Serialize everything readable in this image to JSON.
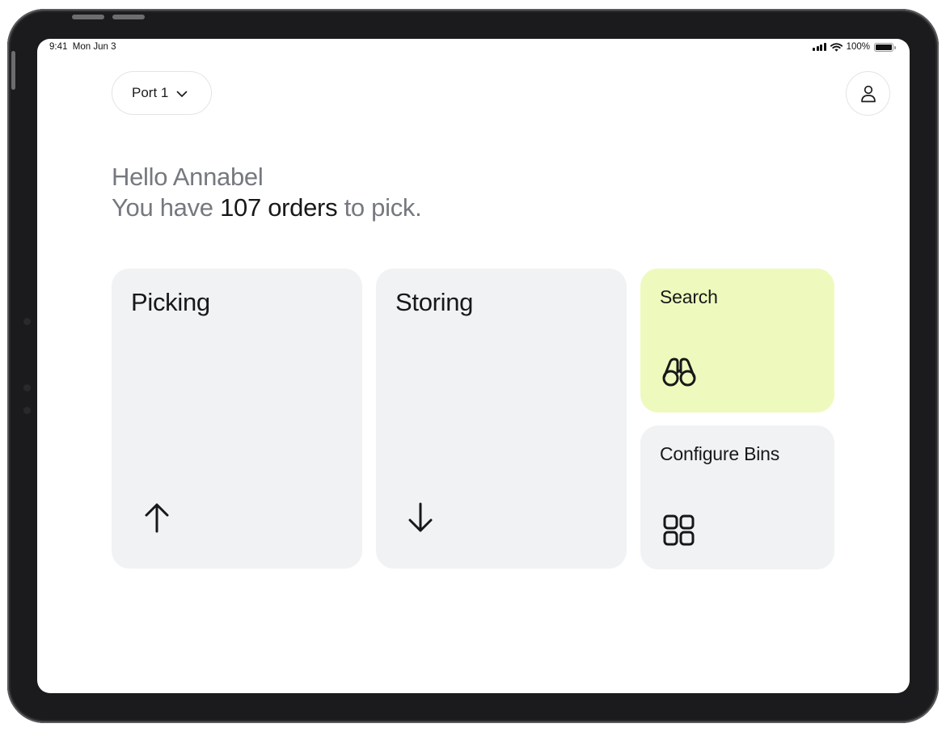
{
  "status_bar": {
    "time": "9:41",
    "date": "Mon Jun 3",
    "battery": "100%",
    "battery_level": 1.0
  },
  "header": {
    "port_selector": {
      "label": "Port 1",
      "icon": "chevron-down-icon"
    },
    "profile": {
      "icon": "user-icon"
    }
  },
  "greeting": {
    "line1": "Hello Annabel",
    "line2_prefix": "You have ",
    "line2_highlight": "107 orders",
    "line2_suffix": " to pick."
  },
  "tiles": {
    "picking": {
      "label": "Picking",
      "icon": "arrow-up-icon"
    },
    "storing": {
      "label": "Storing",
      "icon": "arrow-down-icon"
    },
    "search": {
      "label": "Search",
      "icon": "binoculars-icon",
      "background": "#eefabd"
    },
    "configure_bins": {
      "label": "Configure Bins",
      "icon": "grid-icon"
    }
  },
  "colors": {
    "tile_background": "#f1f2f4",
    "accent": "#eefabd",
    "text_primary": "#17181a",
    "text_secondary": "#75797f"
  }
}
